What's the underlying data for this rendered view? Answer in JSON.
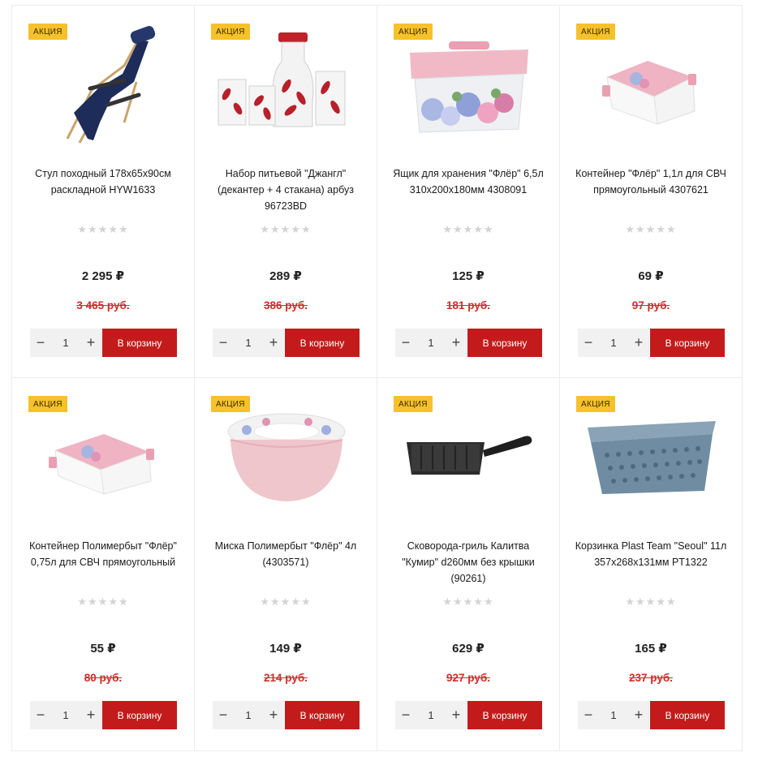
{
  "products": [
    {
      "badge": "АКЦИЯ",
      "image_icon": "folding-chair-icon",
      "title": "Стул походный 178х65х90см раскладной HYW1633",
      "stars": "★★★★★",
      "price": "2 295 ₽",
      "old_price": "3 465 руб.",
      "qty": "1",
      "minus": "−",
      "plus": "+",
      "cart_label": "В корзину"
    },
    {
      "badge": "АКЦИЯ",
      "image_icon": "drinking-set-icon",
      "title": "Набор питьевой \"Джангл\" (декантер + 4 стакана) арбуз 96723BD",
      "stars": "★★★★★",
      "price": "289 ₽",
      "old_price": "386 руб.",
      "qty": "1",
      "minus": "−",
      "plus": "+",
      "cart_label": "В корзину"
    },
    {
      "badge": "АКЦИЯ",
      "image_icon": "storage-box-icon",
      "title": "Ящик для хранения \"Флёр\" 6,5л 310х200х180мм 4308091",
      "stars": "★★★★★",
      "price": "125 ₽",
      "old_price": "181 руб.",
      "qty": "1",
      "minus": "−",
      "plus": "+",
      "cart_label": "В корзину"
    },
    {
      "badge": "АКЦИЯ",
      "image_icon": "food-container-icon",
      "title": "Контейнер \"Флёр\" 1,1л для СВЧ прямоугольный 4307621",
      "stars": "★★★★★",
      "price": "69 ₽",
      "old_price": "97 руб.",
      "qty": "1",
      "minus": "−",
      "plus": "+",
      "cart_label": "В корзину"
    },
    {
      "badge": "АКЦИЯ",
      "image_icon": "food-container-small-icon",
      "title": "Контейнер Полимербыт \"Флёр\" 0,75л для СВЧ прямоугольный",
      "stars": "★★★★★",
      "price": "55 ₽",
      "old_price": "80 руб.",
      "qty": "1",
      "minus": "−",
      "plus": "+",
      "cart_label": "В корзину"
    },
    {
      "badge": "АКЦИЯ",
      "image_icon": "bowl-icon",
      "title": "Миска Полимербыт \"Флёр\" 4л (4303571)",
      "stars": "★★★★★",
      "price": "149 ₽",
      "old_price": "214 руб.",
      "qty": "1",
      "minus": "−",
      "plus": "+",
      "cart_label": "В корзину"
    },
    {
      "badge": "АКЦИЯ",
      "image_icon": "grill-pan-icon",
      "title": "Сковорода-гриль Калитва \"Кумир\" d260мм без крышки (90261)",
      "stars": "★★★★★",
      "price": "629 ₽",
      "old_price": "927 руб.",
      "qty": "1",
      "minus": "−",
      "plus": "+",
      "cart_label": "В корзину"
    },
    {
      "badge": "АКЦИЯ",
      "image_icon": "basket-icon",
      "title": "Корзинка Plast Team \"Seoul\" 11л 357х268х131мм PT1322",
      "stars": "★★★★★",
      "price": "165 ₽",
      "old_price": "237 руб.",
      "qty": "1",
      "minus": "−",
      "plus": "+",
      "cart_label": "В корзину"
    }
  ],
  "colors": {
    "badge": "#f6c12a",
    "cart_button": "#c31b1b",
    "old_price": "#c9302c",
    "star_empty": "#d3d3d3",
    "qty_bg": "#f1f1f1"
  }
}
